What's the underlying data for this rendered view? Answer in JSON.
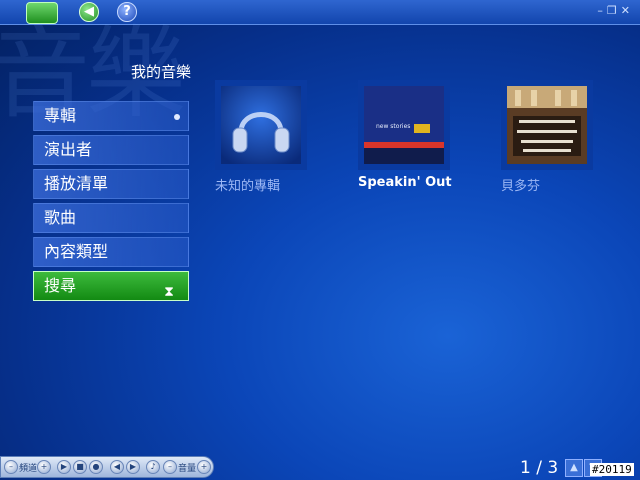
{
  "watermark": "音樂",
  "page_title": "我的音樂",
  "menu": [
    {
      "label": "專輯",
      "selected": false,
      "indicator": true
    },
    {
      "label": "演出者",
      "selected": false,
      "indicator": false
    },
    {
      "label": "播放清單",
      "selected": false,
      "indicator": false
    },
    {
      "label": "歌曲",
      "selected": false,
      "indicator": false
    },
    {
      "label": "內容類型",
      "selected": false,
      "indicator": false
    },
    {
      "label": "搜尋",
      "selected": true,
      "indicator": false
    }
  ],
  "albums": [
    {
      "title": "未知的專輯",
      "art": "headphones-art"
    },
    {
      "title": "Speakin' Out",
      "art": "speakin-out-cover"
    },
    {
      "title": "貝多芬",
      "art": "orchestra-photo"
    }
  ],
  "album_art_text": "new stories",
  "bottom_bar": {
    "channel_label": "頻道",
    "volume_label": "音量"
  },
  "pagination": {
    "text": "1 / 3"
  },
  "build_tag": "#20119",
  "colors": {
    "background": "#0b46b8",
    "selected": "#1f9a1f",
    "menu_bg": "#3c6edc"
  }
}
